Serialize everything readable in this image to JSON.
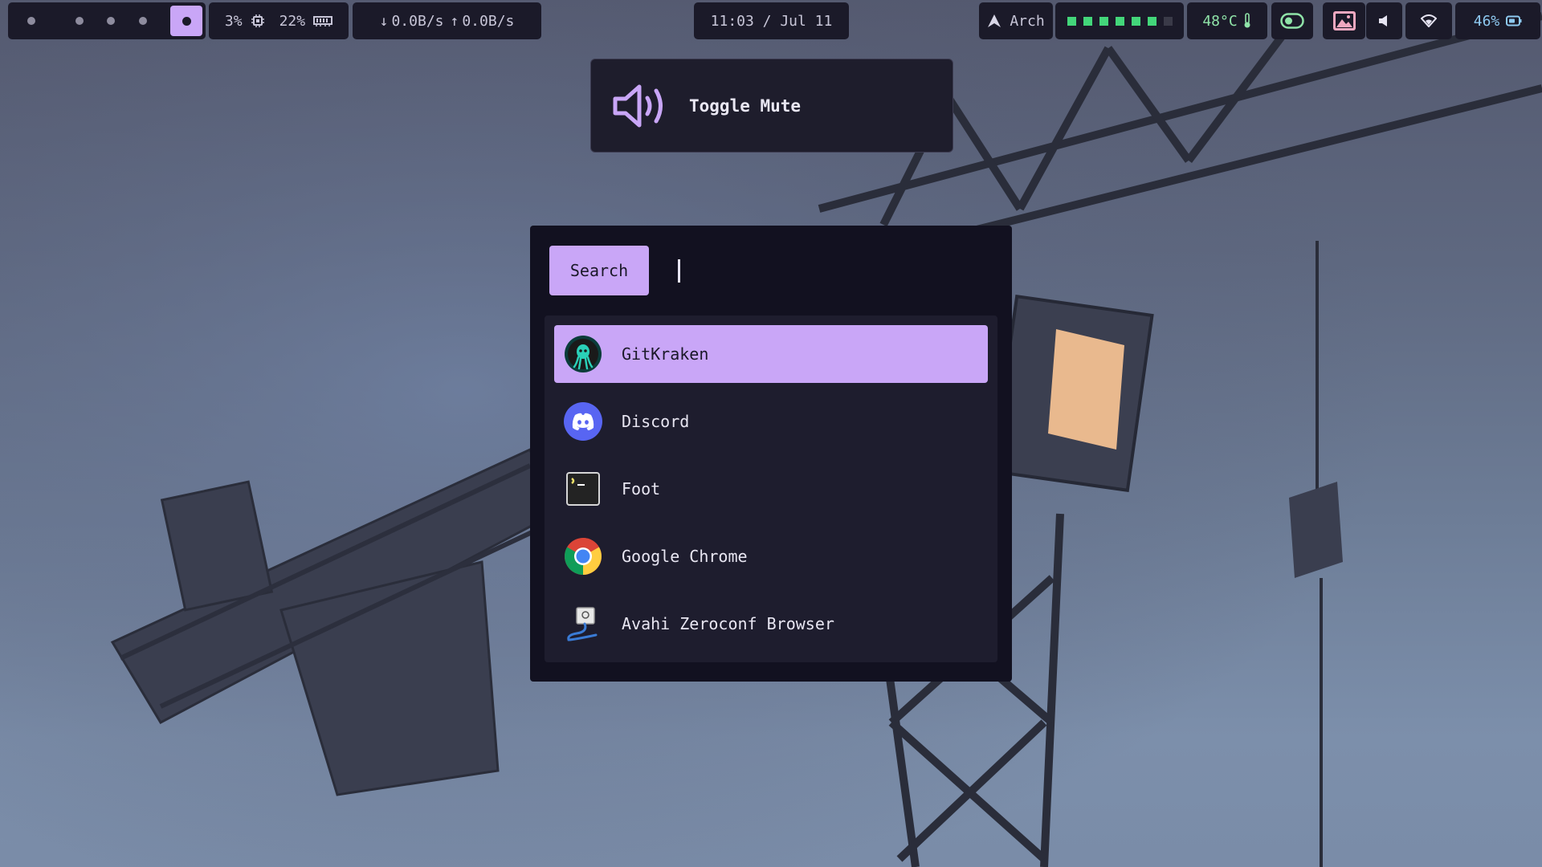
{
  "topbar": {
    "workspaces": {
      "count": 5,
      "active_index": 4
    },
    "cpu": "3%",
    "memory": "22%",
    "network": {
      "down": "0.0B/s",
      "up": "0.0B/s"
    },
    "clock": "11:03 / Jul 11",
    "distro": "Arch",
    "visualizer_levels": [
      1,
      1,
      1,
      1,
      1,
      1,
      0
    ],
    "temperature": "48°C",
    "battery": "46%",
    "colors": {
      "accent": "#c9a6f7",
      "bar_bg": "#1b1a29",
      "temp": "#8fe3a8",
      "battery": "#8ec9f0",
      "visualizer": "#43d67a"
    }
  },
  "osd": {
    "label": "Toggle Mute",
    "icon": "speaker-icon"
  },
  "launcher": {
    "search_label": "Search",
    "query": "",
    "results": [
      {
        "name": "GitKraken",
        "icon": "gitkraken-icon",
        "selected": true
      },
      {
        "name": "Discord",
        "icon": "discord-icon",
        "selected": false
      },
      {
        "name": "Foot",
        "icon": "terminal-icon",
        "selected": false
      },
      {
        "name": "Google Chrome",
        "icon": "chrome-icon",
        "selected": false
      },
      {
        "name": "Avahi Zeroconf Browser",
        "icon": "avahi-icon",
        "selected": false
      }
    ]
  }
}
